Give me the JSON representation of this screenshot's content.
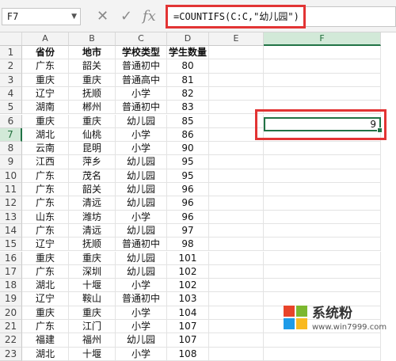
{
  "toolbar": {
    "name_box": "F7",
    "cancel_glyph": "✕",
    "confirm_glyph": "✓",
    "fx_label": "fx",
    "formula": "=COUNTIFS(C:C,\"幼儿园\")"
  },
  "columns": [
    "",
    "A",
    "B",
    "C",
    "D",
    "E",
    "F"
  ],
  "header_row": [
    "省份",
    "地市",
    "学校类型",
    "学生数量"
  ],
  "rows": [
    [
      "广东",
      "韶关",
      "普通初中",
      "80"
    ],
    [
      "重庆",
      "重庆",
      "普通高中",
      "81"
    ],
    [
      "辽宁",
      "抚顺",
      "小学",
      "82"
    ],
    [
      "湖南",
      "郴州",
      "普通初中",
      "83"
    ],
    [
      "重庆",
      "重庆",
      "幼儿园",
      "85"
    ],
    [
      "湖北",
      "仙桃",
      "小学",
      "86"
    ],
    [
      "云南",
      "昆明",
      "小学",
      "90"
    ],
    [
      "江西",
      "萍乡",
      "幼儿园",
      "95"
    ],
    [
      "广东",
      "茂名",
      "幼儿园",
      "95"
    ],
    [
      "广东",
      "韶关",
      "幼儿园",
      "96"
    ],
    [
      "广东",
      "清远",
      "幼儿园",
      "96"
    ],
    [
      "山东",
      "潍坊",
      "小学",
      "96"
    ],
    [
      "广东",
      "清远",
      "幼儿园",
      "97"
    ],
    [
      "辽宁",
      "抚顺",
      "普通初中",
      "98"
    ],
    [
      "重庆",
      "重庆",
      "幼儿园",
      "101"
    ],
    [
      "广东",
      "深圳",
      "幼儿园",
      "102"
    ],
    [
      "湖北",
      "十堰",
      "小学",
      "102"
    ],
    [
      "辽宁",
      "鞍山",
      "普通初中",
      "103"
    ],
    [
      "重庆",
      "重庆",
      "小学",
      "104"
    ],
    [
      "广东",
      "江门",
      "小学",
      "107"
    ],
    [
      "福建",
      "福州",
      "幼儿园",
      "107"
    ],
    [
      "湖北",
      "十堰",
      "小学",
      "108"
    ]
  ],
  "active_cell": {
    "ref": "F7",
    "value": "9"
  },
  "watermark": {
    "name": "系统粉",
    "url": "www.win7999.com"
  },
  "colors": {
    "accent": "#217346",
    "highlight": "#e23434"
  }
}
